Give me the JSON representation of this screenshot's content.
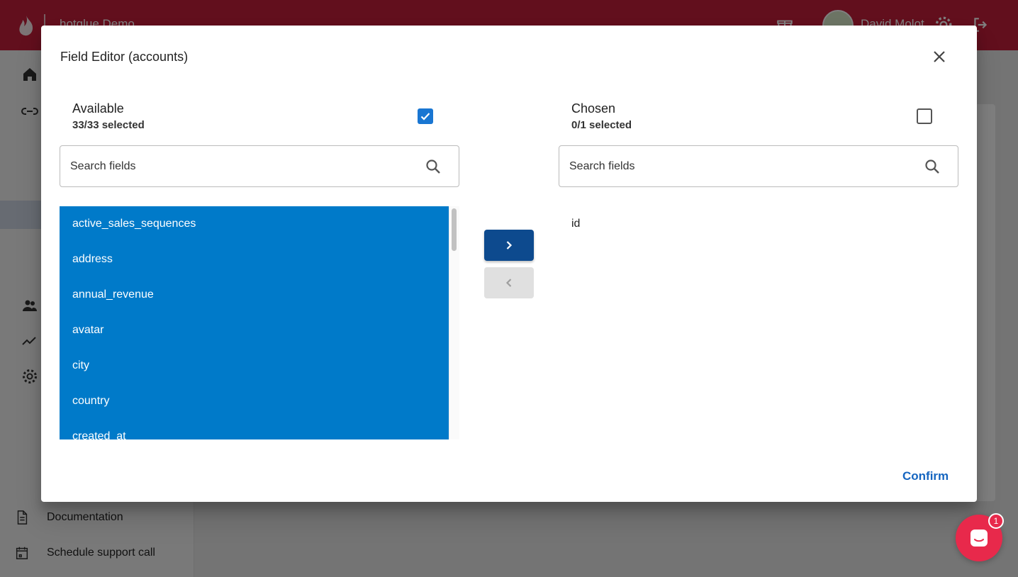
{
  "topbar": {
    "org_name": "hotglue Demo",
    "user_name": "David Molot"
  },
  "sidebar": {
    "documentation_label": "Documentation",
    "support_call_label": "Schedule support call"
  },
  "modal": {
    "title": "Field Editor (accounts)",
    "available": {
      "heading": "Available",
      "count": "33/33 selected",
      "all_checked": true,
      "search_placeholder": "Search fields",
      "items": [
        "active_sales_sequences",
        "address",
        "annual_revenue",
        "avatar",
        "city",
        "country",
        "created_at"
      ]
    },
    "chosen": {
      "heading": "Chosen",
      "count": "0/1 selected",
      "all_checked": false,
      "search_placeholder": "Search fields",
      "items": [
        "id"
      ]
    },
    "confirm_label": "Confirm"
  },
  "chat": {
    "badge_count": "1"
  },
  "colors": {
    "brand_red": "#c41e3a",
    "selected_blue": "#007ac9",
    "primary_button": "#0d4a8e",
    "confirm_blue": "#1565c0"
  }
}
